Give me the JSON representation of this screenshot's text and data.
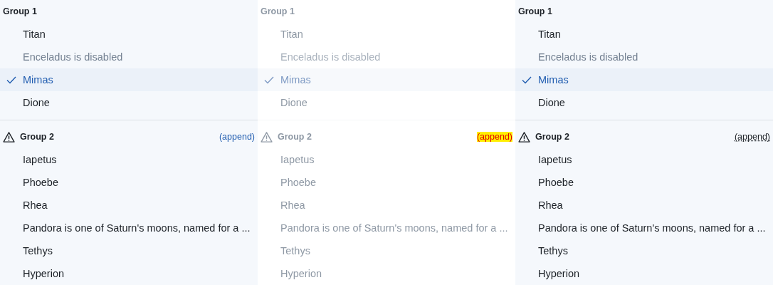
{
  "panels": [
    {
      "kind": "default",
      "groups": [
        {
          "label": "Group 1",
          "warning": false,
          "items": [
            {
              "label": "Titan",
              "disabled": false,
              "selected": false
            },
            {
              "label": "Enceladus is disabled",
              "disabled": true,
              "selected": false
            },
            {
              "label": "Mimas",
              "disabled": false,
              "selected": true
            },
            {
              "label": "Dione",
              "disabled": false,
              "selected": false
            }
          ]
        },
        {
          "label": "Group 2",
          "warning": true,
          "append": "(append)",
          "items": [
            {
              "label": "Iapetus",
              "disabled": false,
              "selected": false
            },
            {
              "label": "Phoebe",
              "disabled": false,
              "selected": false
            },
            {
              "label": "Rhea",
              "disabled": false,
              "selected": false
            },
            {
              "label": "Pandora is one of Saturn's moons, named for a ...",
              "disabled": false,
              "selected": false
            },
            {
              "label": "Tethys",
              "disabled": false,
              "selected": false
            },
            {
              "label": "Hyperion",
              "disabled": false,
              "selected": false
            }
          ]
        }
      ]
    },
    {
      "kind": "disabled",
      "groups": [
        {
          "label": "Group 1",
          "warning": false,
          "items": [
            {
              "label": "Titan",
              "disabled": false,
              "selected": false
            },
            {
              "label": "Enceladus is disabled",
              "disabled": true,
              "selected": false
            },
            {
              "label": "Mimas",
              "disabled": false,
              "selected": true
            },
            {
              "label": "Dione",
              "disabled": false,
              "selected": false
            }
          ]
        },
        {
          "label": "Group 2",
          "warning": true,
          "append": "(append)",
          "items": [
            {
              "label": "Iapetus",
              "disabled": false,
              "selected": false
            },
            {
              "label": "Phoebe",
              "disabled": false,
              "selected": false
            },
            {
              "label": "Rhea",
              "disabled": false,
              "selected": false
            },
            {
              "label": "Pandora is one of Saturn's moons, named for a ...",
              "disabled": false,
              "selected": false
            },
            {
              "label": "Tethys",
              "disabled": false,
              "selected": false
            },
            {
              "label": "Hyperion",
              "disabled": false,
              "selected": false
            }
          ]
        }
      ]
    },
    {
      "kind": "plain",
      "groups": [
        {
          "label": "Group 1",
          "warning": false,
          "items": [
            {
              "label": "Titan",
              "disabled": false,
              "selected": false
            },
            {
              "label": "Enceladus is disabled",
              "disabled": true,
              "selected": false
            },
            {
              "label": "Mimas",
              "disabled": false,
              "selected": true
            },
            {
              "label": "Dione",
              "disabled": false,
              "selected": false
            }
          ]
        },
        {
          "label": "Group 2",
          "warning": true,
          "append": "(append)",
          "items": [
            {
              "label": "Iapetus",
              "disabled": false,
              "selected": false
            },
            {
              "label": "Phoebe",
              "disabled": false,
              "selected": false
            },
            {
              "label": "Rhea",
              "disabled": false,
              "selected": false
            },
            {
              "label": "Pandora is one of Saturn's moons, named for a ...",
              "disabled": false,
              "selected": false
            },
            {
              "label": "Tethys",
              "disabled": false,
              "selected": false
            },
            {
              "label": "Hyperion",
              "disabled": false,
              "selected": false
            }
          ]
        }
      ]
    }
  ]
}
